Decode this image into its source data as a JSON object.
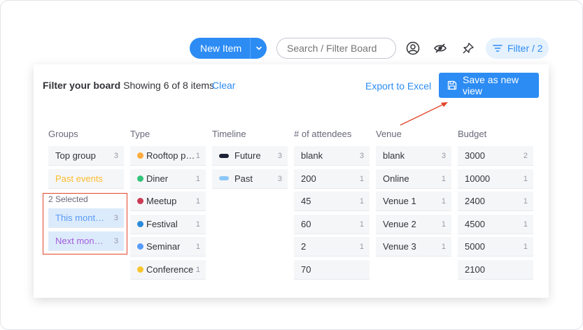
{
  "toolbar": {
    "new_item_label": "New Item",
    "search_placeholder": "Search / Filter Board",
    "filter_label": "Filter / 2",
    "icons": [
      "chevron-down-icon",
      "person-icon",
      "eye-off-icon",
      "pin-icon",
      "filter-icon"
    ]
  },
  "panel": {
    "title_bold": "Filter your board",
    "showing": "Showing 6 of 8 items",
    "clear_label": "Clear",
    "export_label": "Export to Excel",
    "save_view_label": "Save as new view",
    "selected_label": "2 Selected"
  },
  "columns": {
    "groups": {
      "header": "Groups",
      "options": [
        {
          "label": "Top group",
          "count": "3",
          "color": "#323338"
        },
        {
          "label": "Past events",
          "count": "",
          "color": "#fdbc2c"
        },
        {
          "label": "This month e...",
          "count": "3",
          "color": "#579bfc"
        },
        {
          "label": "Next month e...",
          "count": "3",
          "color": "#a25ddc"
        }
      ]
    },
    "type": {
      "header": "Type",
      "options": [
        {
          "label": "Rooftop par...",
          "count": "1",
          "dot": "#fdab3d"
        },
        {
          "label": "Diner",
          "count": "1",
          "dot": "#33c47a"
        },
        {
          "label": "Meetup",
          "count": "1",
          "dot": "#cc3b55"
        },
        {
          "label": "Festival",
          "count": "1",
          "dot": "#2b8ad9"
        },
        {
          "label": "Seminar",
          "count": "1",
          "dot": "#579bfc"
        },
        {
          "label": "Conference",
          "count": "1",
          "dot": "#f7c52d"
        }
      ]
    },
    "timeline": {
      "header": "Timeline",
      "options": [
        {
          "label": "Future",
          "count": "3",
          "pill": "#1f2236"
        },
        {
          "label": "Past",
          "count": "3",
          "pill": "#8dc6f5"
        }
      ]
    },
    "attendees": {
      "header": "# of attendees",
      "options": [
        {
          "label": "blank",
          "count": "3"
        },
        {
          "label": "200",
          "count": "1"
        },
        {
          "label": "45",
          "count": "1"
        },
        {
          "label": "60",
          "count": "1"
        },
        {
          "label": "2",
          "count": "1"
        },
        {
          "label": "70",
          "count": ""
        }
      ]
    },
    "venue": {
      "header": "Venue",
      "options": [
        {
          "label": "blank",
          "count": "3"
        },
        {
          "label": "Online",
          "count": "1"
        },
        {
          "label": "Venue 1",
          "count": "1"
        },
        {
          "label": "Venue 2",
          "count": "1"
        },
        {
          "label": "Venue 3",
          "count": "1"
        }
      ]
    },
    "budget": {
      "header": "Budget",
      "options": [
        {
          "label": "3000",
          "count": "2"
        },
        {
          "label": "10000",
          "count": "1"
        },
        {
          "label": "2400",
          "count": "1"
        },
        {
          "label": "4500",
          "count": "1"
        },
        {
          "label": "5000",
          "count": "1"
        },
        {
          "label": "2100",
          "count": ""
        }
      ]
    }
  },
  "colors": {
    "accent": "#2c8cf4",
    "annotation": "#e2462b",
    "selected_bg": "#dcebfb"
  }
}
